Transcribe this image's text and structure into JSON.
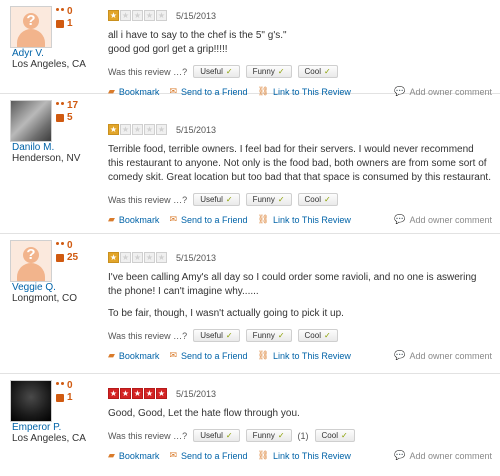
{
  "vote_prompt": "Was this review …?",
  "buttons": {
    "useful": "Useful",
    "funny": "Funny",
    "cool": "Cool"
  },
  "actions": {
    "bookmark": "Bookmark",
    "send": "Send to a Friend",
    "link": "Link to This Review",
    "owner": "Add owner comment"
  },
  "reviews": [
    {
      "user": {
        "name": "Adyr V.",
        "location": "Los Angeles, CA",
        "friends": "0",
        "reviews": "1",
        "avatar": "default"
      },
      "rating": 1,
      "date": "5/15/2013",
      "paragraphs": [
        "all i have to say to the chef is the 5\" g's.\"\ngood god gorl get a grip!!!!!"
      ],
      "funny_count": ""
    },
    {
      "user": {
        "name": "Danilo M.",
        "location": "Henderson, NV",
        "friends": "17",
        "reviews": "5",
        "avatar": "photo"
      },
      "rating": 1,
      "date": "5/15/2013",
      "paragraphs": [
        "Terrible food, terrible owners. I feel bad for their servers. I would never recommend this restaurant to anyone. Not only is the food bad, both owners are from some sort of comedy skit. Great location but too bad that that space is consumed by this restaurant."
      ],
      "funny_count": ""
    },
    {
      "user": {
        "name": "Veggie Q.",
        "location": "Longmont, CO",
        "friends": "0",
        "reviews": "25",
        "avatar": "default"
      },
      "rating": 1,
      "date": "5/15/2013",
      "paragraphs": [
        "I've been calling Amy's all day so I could order some ravioli, and no one is aswering the phone! I can't imagine why......",
        "To be fair, though, I wasn't actually going to pick it up."
      ],
      "funny_count": ""
    },
    {
      "user": {
        "name": "Emperor P.",
        "location": "Los Angeles, CA",
        "friends": "0",
        "reviews": "1",
        "avatar": "photo"
      },
      "rating": 5,
      "date": "5/15/2013",
      "paragraphs": [
        "Good, Good, Let the hate flow through you."
      ],
      "funny_count": "(1)"
    }
  ]
}
